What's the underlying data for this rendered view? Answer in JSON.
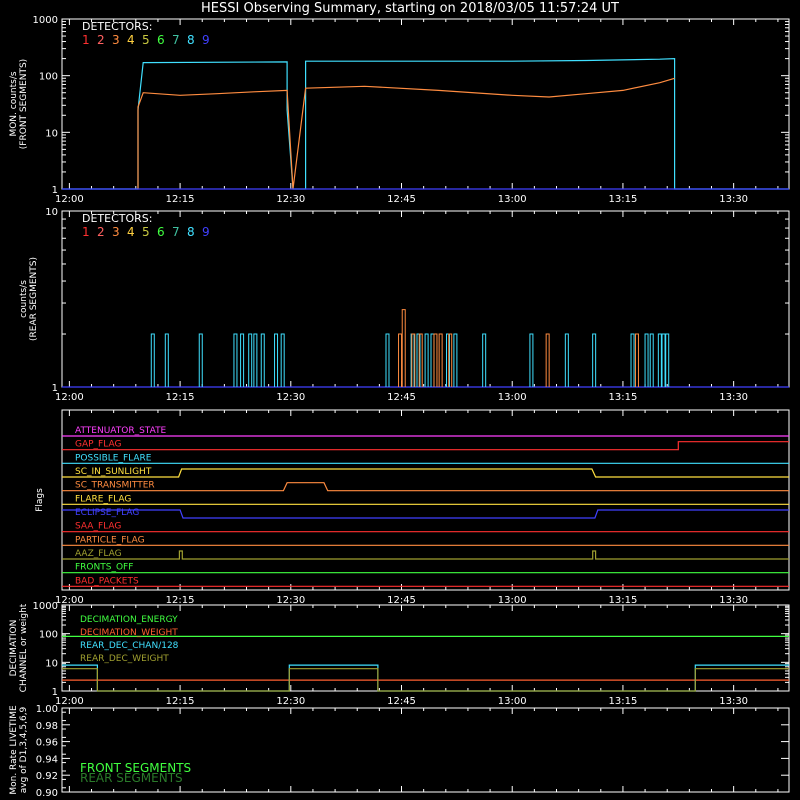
{
  "chart_data": {
    "type": "line",
    "title": "HESSI Observing Summary, starting on 2018/03/05 11:57:24 UT",
    "detectors_label": "DETECTORS:",
    "detectors": [
      {
        "label": "1",
        "color": "#ff3030"
      },
      {
        "label": "2",
        "color": "#ff6060"
      },
      {
        "label": "3",
        "color": "#ff8c40"
      },
      {
        "label": "4",
        "color": "#ffd040"
      },
      {
        "label": "5",
        "color": "#c8c840"
      },
      {
        "label": "6",
        "color": "#40ff40"
      },
      {
        "label": "7",
        "color": "#40c0a0"
      },
      {
        "label": "8",
        "color": "#40e0ff"
      },
      {
        "label": "9",
        "color": "#4040ff"
      }
    ],
    "x_ticks": [
      "12:00",
      "12:15",
      "12:30",
      "12:45",
      "13:00",
      "13:15",
      "13:30"
    ],
    "x_tick_minutes": [
      0,
      15,
      30,
      45,
      60,
      75,
      90
    ],
    "xlim_minutes": [
      -1,
      97.5
    ],
    "panels": [
      {
        "name": "front",
        "ylabel": [
          "MON. counts/s",
          "(FRONT SEGMENTS)"
        ],
        "yscale": "log",
        "ylim": [
          1,
          1000
        ],
        "y_ticks": [
          "1",
          "10",
          "100",
          "1000"
        ],
        "series": [
          {
            "detector": "8",
            "color": "#40e0ff",
            "x": [
              -1,
              9.3,
              9.3,
              10,
              29.5,
              29.5,
              30.3,
              30.3,
              32,
              32,
              60,
              70,
              80,
              82,
              82,
              97.5
            ],
            "y": [
              1,
              1,
              25,
              170,
              175,
              25,
              1,
              1,
              1,
              180,
              180,
              185,
              195,
              200,
              1,
              1
            ]
          },
          {
            "detector": "3",
            "color": "#ff8c40",
            "x": [
              9.3,
              9.3,
              10,
              15,
              20,
              25,
              29.5,
              30.3,
              32,
              40,
              50,
              60,
              65,
              70,
              75,
              80,
              82
            ],
            "y": [
              1,
              28,
              50,
              45,
              48,
              52,
              55,
              1,
              60,
              65,
              55,
              45,
              42,
              48,
              55,
              75,
              90
            ]
          },
          {
            "detector": "9",
            "color": "#4040ff",
            "x": [
              -1,
              97.5
            ],
            "y": [
              1,
              1
            ]
          }
        ]
      },
      {
        "name": "rear",
        "ylabel": [
          "counts/s",
          "(REAR SEGMENTS)"
        ],
        "yscale": "log",
        "ylim": [
          1,
          10
        ],
        "y_ticks": [
          "1",
          "10"
        ],
        "spikes": [
          {
            "color": "#40e0ff",
            "y": 2,
            "minutes": [
              11.3,
              13.2,
              17.8,
              22.5,
              23.4,
              24.5,
              25.2,
              26.2,
              28.0,
              28.9,
              43.1,
              46.5,
              47.3,
              48.4,
              49.2,
              51.3,
              52.3,
              56.2,
              62.6,
              67.4,
              71.1,
              76.3,
              78.2,
              78.9,
              80.0,
              80.5,
              81.0
            ]
          },
          {
            "color": "#ff8c40",
            "y": 2,
            "minutes": [
              44.8,
              46.6,
              47.6,
              49.6,
              50.3,
              51.6,
              64.8,
              76.9
            ]
          },
          {
            "color": "#ff8c40",
            "y": 2.75,
            "minutes": [
              45.3
            ]
          },
          {
            "color": "#4040ff",
            "y": 1,
            "minutes": []
          }
        ]
      },
      {
        "name": "flags",
        "ylabel": "Flags",
        "x_ticks_labeled": true,
        "flags": [
          {
            "label": "ATTENUATOR_STATE",
            "color": "#ff40ff",
            "x": [
              -1,
              97.5
            ],
            "y": [
              0,
              0
            ]
          },
          {
            "label": "GAP_FLAG",
            "color": "#ff3030",
            "x": [
              -1,
              6.5,
              6.5,
              82.5,
              82.5,
              97.5
            ],
            "y": [
              0,
              0,
              0,
              0,
              1,
              1
            ]
          },
          {
            "label": "POSSIBLE_FLARE",
            "color": "#40e0ff",
            "x": [
              -1,
              97.5
            ],
            "y": [
              0,
              0
            ]
          },
          {
            "label": "SC_IN_SUNLIGHT",
            "color": "#ffe040",
            "x": [
              -1,
              14.8,
              15.2,
              70.8,
              71.3,
              97.5
            ],
            "y": [
              0,
              0,
              1,
              1,
              0,
              0
            ]
          },
          {
            "label": "SC_TRANSMITTER",
            "color": "#ff8c40",
            "x": [
              -1,
              29,
              29.5,
              34.5,
              35,
              97.5
            ],
            "y": [
              0,
              0,
              1,
              1,
              0,
              0
            ]
          },
          {
            "label": "FLARE_FLAG",
            "color": "#ffe040",
            "x": [
              -1,
              97.5
            ],
            "y": [
              0,
              0
            ]
          },
          {
            "label": "ECLIPSE_FLAG",
            "color": "#4040ff",
            "x": [
              -1,
              15,
              15.4,
              71.2,
              71.6,
              97.5
            ],
            "y": [
              1,
              1,
              0,
              0,
              1,
              1
            ]
          },
          {
            "label": "SAA_FLAG",
            "color": "#ff3030",
            "x": [
              -1,
              97.5
            ],
            "y": [
              0,
              0
            ]
          },
          {
            "label": "PARTICLE_FLAG",
            "color": "#ff8c40",
            "x": [
              -1,
              97.5
            ],
            "y": [
              0,
              0
            ]
          },
          {
            "label": "AAZ_FLAG",
            "color": "#a0a030",
            "x": [
              -1,
              14.9,
              14.9,
              15.3,
              15.3,
              70.9,
              70.9,
              71.3,
              71.3,
              97.5
            ],
            "y": [
              0,
              0,
              1,
              1,
              0,
              0,
              1,
              1,
              0,
              0
            ]
          },
          {
            "label": "FRONTS_OFF",
            "color": "#40ff40",
            "x": [
              -1,
              97.5
            ],
            "y": [
              0,
              0
            ]
          },
          {
            "label": "BAD_PACKETS",
            "color": "#ff3030",
            "x": [
              -1,
              97.5
            ],
            "y": [
              0,
              0
            ]
          }
        ]
      },
      {
        "name": "decimation",
        "ylabel": [
          "DECIMATION",
          "CHANNEL or weight"
        ],
        "yscale": "log",
        "ylim": [
          1,
          1000
        ],
        "y_ticks": [
          "1",
          "10",
          "100",
          "1000"
        ],
        "series": [
          {
            "label": "DECIMATION_ENERGY",
            "color": "#40ff40",
            "x": [
              -1,
              97.5
            ],
            "y": [
              80,
              80
            ]
          },
          {
            "label": "DECIMATION_WEIGHT",
            "color": "#ff6030",
            "x": [
              -1,
              97.5
            ],
            "y": [
              2.4,
              2.4
            ]
          },
          {
            "label": "REAR_DEC_CHAN/128",
            "color": "#40e0ff",
            "x": [
              -1,
              3.8,
              3.8,
              29.8,
              29.8,
              41.8,
              41.8,
              84.8,
              84.8,
              97.5
            ],
            "y": [
              8,
              8,
              1,
              1,
              8,
              8,
              1,
              1,
              8,
              8
            ]
          },
          {
            "label": "REAR_DEC_WEIGHT",
            "color": "#a0a030",
            "x": [
              -1,
              3.8,
              3.8,
              29.8,
              29.8,
              41.8,
              41.8,
              84.8,
              84.8,
              97.5
            ],
            "y": [
              6,
              6,
              1,
              1,
              6,
              6,
              1,
              1,
              6,
              6
            ]
          }
        ]
      },
      {
        "name": "livetime",
        "ylabel": [
          "Mon. Rate LIVETIME",
          "avg of D1,3,4,5,6,9"
        ],
        "ylim": [
          0.9,
          1.0
        ],
        "y_ticks": [
          "0.90",
          "0.92",
          "0.94",
          "0.96",
          "0.98",
          "1.00"
        ],
        "legend": [
          {
            "label": "FRONT SEGMENTS",
            "color": "#40ff40"
          },
          {
            "label": "REAR SEGMENTS",
            "color": "#2a7a2a"
          }
        ]
      }
    ]
  }
}
